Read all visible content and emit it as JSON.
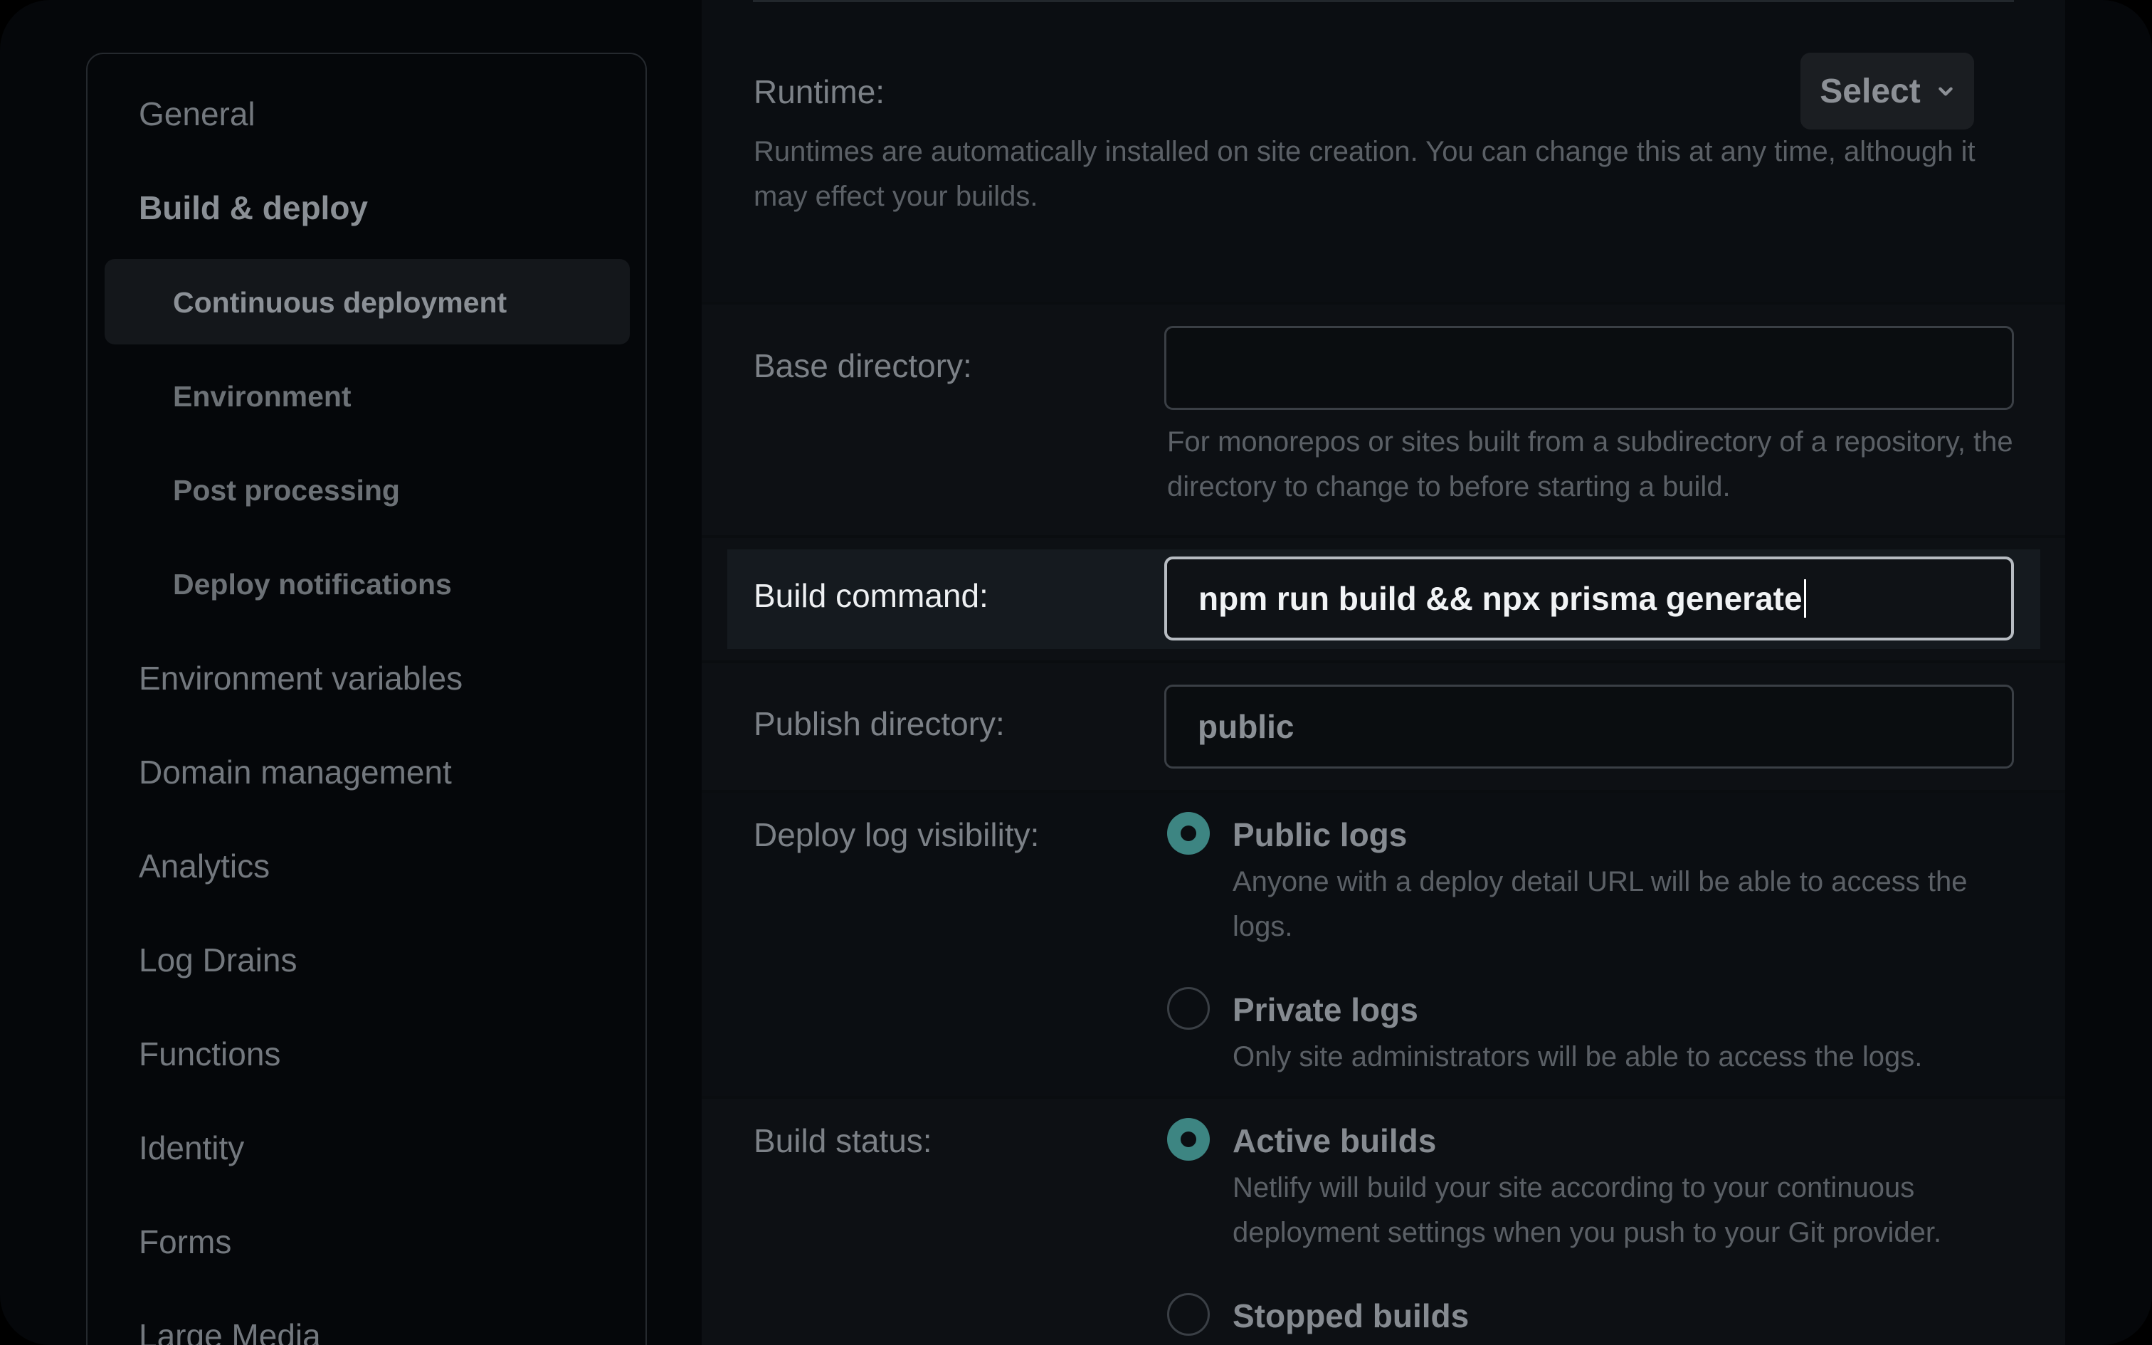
{
  "sidebar": {
    "items": [
      {
        "label": "General"
      },
      {
        "label": "Build & deploy"
      },
      {
        "label": "Continuous deployment"
      },
      {
        "label": "Environment"
      },
      {
        "label": "Post processing"
      },
      {
        "label": "Deploy notifications"
      },
      {
        "label": "Environment variables"
      },
      {
        "label": "Domain management"
      },
      {
        "label": "Analytics"
      },
      {
        "label": "Log Drains"
      },
      {
        "label": "Functions"
      },
      {
        "label": "Identity"
      },
      {
        "label": "Forms"
      },
      {
        "label": "Large Media"
      }
    ],
    "active_item": "Continuous deployment"
  },
  "runtime": {
    "label": "Runtime:",
    "select_label": "Select",
    "description": "Runtimes are automatically installed on site creation. You can change this at any time, although it may effect your builds."
  },
  "base_directory": {
    "label": "Base directory:",
    "value": "",
    "description": "For monorepos or sites built from a subdirectory of a repository, the directory to change to before starting a build."
  },
  "build_command": {
    "label": "Build command:",
    "value": "npm run build && npx prisma generate"
  },
  "publish_directory": {
    "label": "Publish directory:",
    "value": "public"
  },
  "deploy_log_visibility": {
    "label": "Deploy log visibility:",
    "options": [
      {
        "title": "Public logs",
        "description": "Anyone with a deploy detail URL will be able to access the logs.",
        "selected": true
      },
      {
        "title": "Private logs",
        "description": "Only site administrators will be able to access the logs.",
        "selected": false
      }
    ]
  },
  "build_status": {
    "label": "Build status:",
    "options": [
      {
        "title": "Active builds",
        "description": "Netlify will build your site according to your continuous deployment settings when you push to your Git provider.",
        "selected": true
      },
      {
        "title": "Stopped builds",
        "selected": false
      }
    ]
  },
  "colors": {
    "accent_radio": "#3d8582",
    "background": "#05070a",
    "panel": "#0d1014"
  }
}
